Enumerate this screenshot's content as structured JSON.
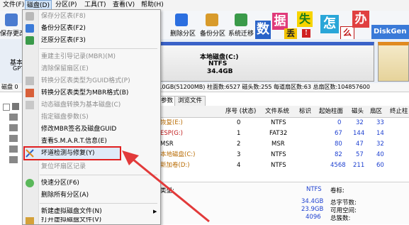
{
  "menubar": {
    "items": [
      "文件(F)",
      "磁盘(D)",
      "分区(P)",
      "工具(T)",
      "查看(V)",
      "帮助(H)"
    ]
  },
  "toolbar": {
    "save_label": "保存更改",
    "delete_partition_label": "删除分区",
    "backup_partition_label": "备份分区",
    "migrate_system_label": "系统迁移"
  },
  "banner": {
    "chars": [
      "数",
      "据",
      "丢",
      "失",
      "怎",
      "么",
      "办",
      "!"
    ],
    "logo_text": "DiskGen"
  },
  "disk_panel": {
    "left_label_1": "基本",
    "left_label_2": "GPT",
    "partition_name": "本地磁盘(C:)",
    "partition_fs": "NTFS",
    "partition_size": "34.4GB"
  },
  "info_line": {
    "prefix": "磁盘 0",
    "text": ".0GB(51200MB)  柱面数:6527  磁头数:255  每道扇区数:63  总扇区数:104857600"
  },
  "tabs": [
    "参数",
    "浏览文件"
  ],
  "table": {
    "columns": [
      "序号 (状态)",
      "文件系统",
      "标识",
      "起始柱面",
      "磁头",
      "扇区",
      "终止柱"
    ],
    "rows": [
      {
        "name": "恢复(E:)",
        "seq": "0",
        "fs": "NTFS",
        "flag": "",
        "start_cyl": "0",
        "head": "32",
        "sector": "33"
      },
      {
        "name": "ESP(G:)",
        "seq": "1",
        "fs": "FAT32",
        "flag": "",
        "start_cyl": "67",
        "head": "144",
        "sector": "14"
      },
      {
        "name": "MSR",
        "seq": "2",
        "fs": "MSR",
        "flag": "",
        "start_cyl": "80",
        "head": "47",
        "sector": "32"
      },
      {
        "name": "本地磁盘(C:)",
        "seq": "3",
        "fs": "NTFS",
        "flag": "",
        "start_cyl": "82",
        "head": "57",
        "sector": "40"
      },
      {
        "name": "新加卷(D:)",
        "seq": "4",
        "fs": "NTFS",
        "flag": "",
        "start_cyl": "4568",
        "head": "211",
        "sector": "60"
      }
    ]
  },
  "details": {
    "type_label": "类型:",
    "type_value": "NTFS",
    "volume_label": "卷标:",
    "total_size": "34.4GB",
    "total_bytes_label": "总字节数:",
    "free_size": "23.9GB",
    "free_label": "可用空间:",
    "cluster_size": "4096",
    "cluster_label": "总簇数:"
  },
  "menu": {
    "items": [
      {
        "label": "保存分区表(F8)",
        "disabled": true,
        "icon": "save-icon"
      },
      {
        "label": "备份分区表(F2)",
        "disabled": false,
        "icon": "backup-icon"
      },
      {
        "label": "还原分区表(F3)",
        "disabled": false,
        "icon": "restore-icon"
      },
      {
        "label": "重建主引导记录(MBR)(M)",
        "disabled": true,
        "icon": ""
      },
      {
        "label": "清除保留扇区(E)",
        "disabled": true,
        "icon": ""
      },
      {
        "label": "转换分区表类型为GUID格式(P)",
        "disabled": true,
        "icon": "convert-icon"
      },
      {
        "label": "转换分区表类型为MBR格式(B)",
        "disabled": false,
        "icon": "convert-icon"
      },
      {
        "label": "动态磁盘转换为基本磁盘(C)",
        "disabled": true,
        "icon": "convert-icon"
      },
      {
        "label": "指定磁盘参数(S)",
        "disabled": true,
        "icon": ""
      },
      {
        "label": "修改MBR签名及磁盘GUID",
        "disabled": false,
        "icon": ""
      },
      {
        "label": "查看S.M.A.R.T.信息(E)",
        "disabled": false,
        "icon": ""
      },
      {
        "label": "坏道检测与修复(Y)",
        "disabled": false,
        "icon": "bad-sector-icon"
      },
      {
        "label": "复位坏扇区记录",
        "disabled": true,
        "icon": ""
      },
      {
        "label": "快速分区(F6)",
        "disabled": false,
        "icon": "quick-partition-icon"
      },
      {
        "label": "删除所有分区(A)",
        "disabled": false,
        "icon": ""
      },
      {
        "label": "新建虚拟磁盘文件(N)",
        "disabled": false,
        "icon": ""
      },
      {
        "label": "打开虚拟磁盘文件(V)",
        "disabled": false,
        "icon": "open-vdisk-icon"
      }
    ]
  },
  "colors": {
    "accent": "#1c3fd0",
    "highlight_box": "#e02020",
    "arrow": "#e23a3a"
  }
}
